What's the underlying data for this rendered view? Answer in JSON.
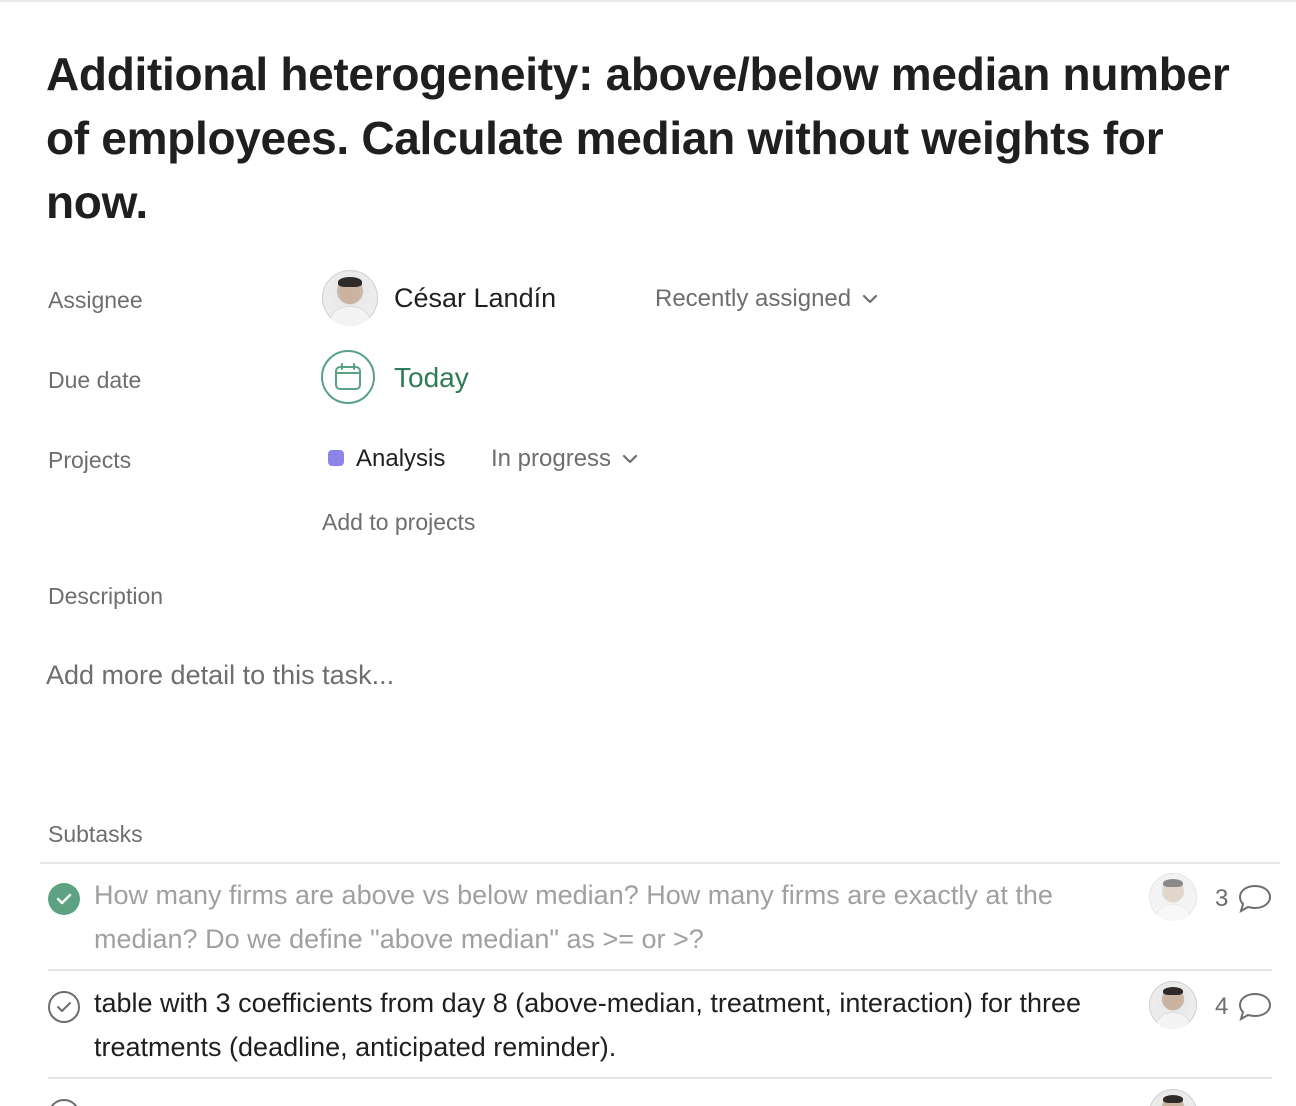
{
  "task": {
    "title": "Additional heterogeneity: above/below median number of employees. Calculate median without weights for now."
  },
  "fields": {
    "assignee_label": "Assignee",
    "assignee_name": "César Landín",
    "assignee_section": "Recently assigned",
    "due_label": "Due date",
    "due_value": "Today",
    "projects_label": "Projects",
    "project_name": "Analysis",
    "project_color": "#8d84e8",
    "project_status": "In progress",
    "add_to_projects": "Add to projects",
    "description_label": "Description",
    "description_placeholder": "Add more detail to this task..."
  },
  "subtasks": {
    "label": "Subtasks",
    "items": [
      {
        "text": "How many firms are above vs below median? How many firms are exactly at the median? Do we define \"above median\" as >= or >?",
        "completed": true,
        "comments": "3"
      },
      {
        "text": "table with 3 coefficients from day 8 (above-median, treatment, interaction) for three treatments (deadline, anticipated reminder).",
        "completed": false,
        "comments": "4"
      }
    ]
  },
  "colors": {
    "accent_green": "#58a182",
    "done_green": "#5da283"
  }
}
